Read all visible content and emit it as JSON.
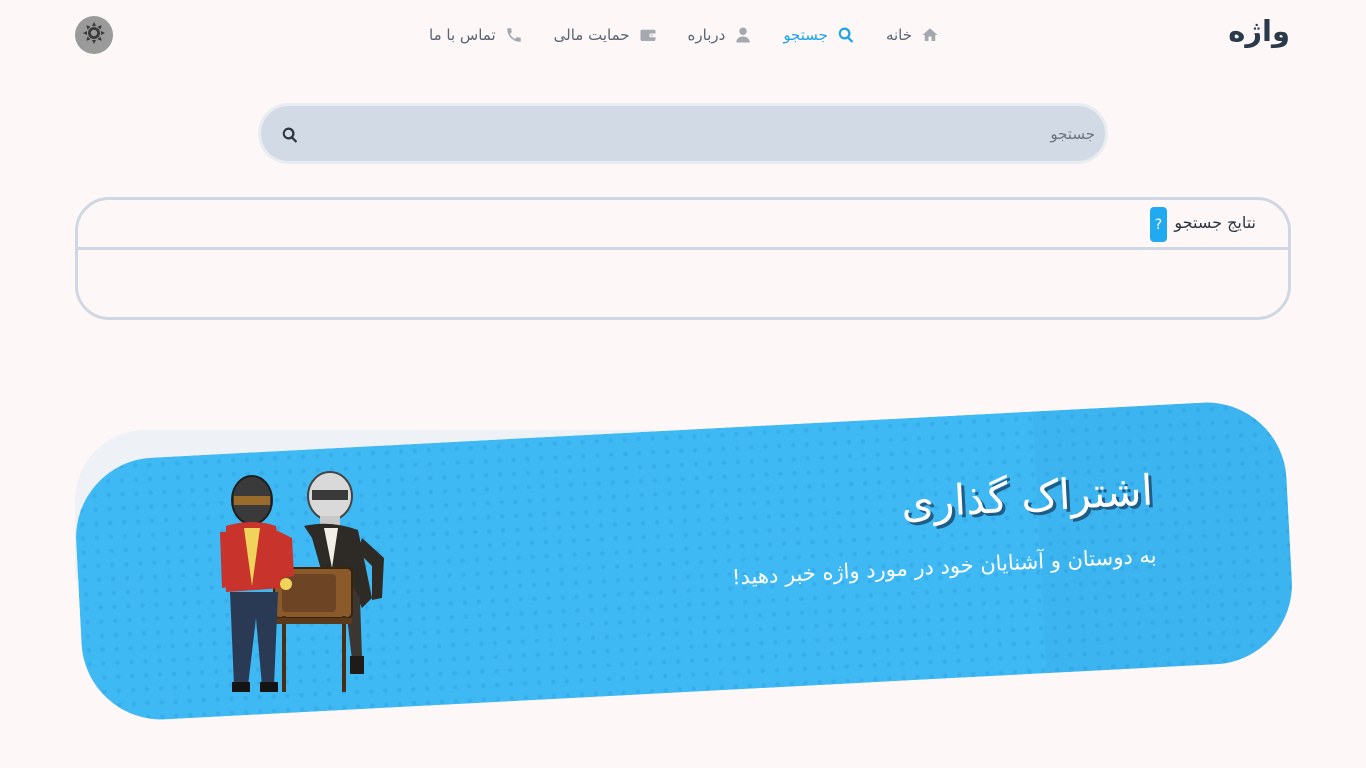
{
  "header": {
    "logo": "واژه",
    "nav": [
      {
        "label": "خانه",
        "icon": "home-icon",
        "active": false
      },
      {
        "label": "جستجو",
        "icon": "search-icon",
        "active": true
      },
      {
        "label": "درباره",
        "icon": "user-icon",
        "active": false
      },
      {
        "label": "حمایت مالی",
        "icon": "wallet-icon",
        "active": false
      },
      {
        "label": "تماس با ما",
        "icon": "phone-icon",
        "active": false
      }
    ],
    "theme_toggle_icon": "sun-icon"
  },
  "search": {
    "placeholder": "جستجو",
    "value": ""
  },
  "results": {
    "title": "نتایج جستجو",
    "help_label": "?"
  },
  "banner": {
    "title": "اشتراک گذاری",
    "subtitle": "به دوستان و آشنایان خود در مورد واژه خبر دهید!"
  },
  "colors": {
    "accent": "#1aa3ea",
    "banner": "#3fb9f4",
    "search_bg": "#d2dbe5",
    "page_bg": "#fdf8f7"
  }
}
